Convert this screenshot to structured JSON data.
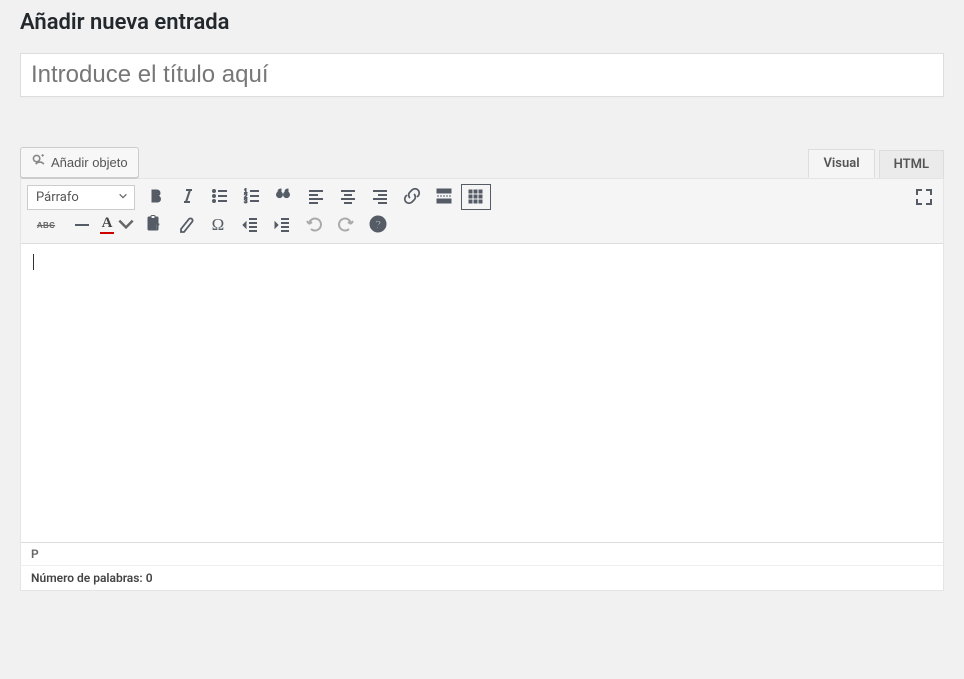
{
  "page": {
    "title": "Añadir nueva entrada"
  },
  "title_input": {
    "placeholder": "Introduce el título aquí",
    "value": ""
  },
  "media": {
    "add_label": "Añadir objeto"
  },
  "tabs": {
    "visual": "Visual",
    "html": "HTML",
    "active": "visual"
  },
  "format_select": {
    "value": "Párrafo"
  },
  "toolbar_row1": [
    {
      "name": "bold-icon"
    },
    {
      "name": "italic-icon"
    },
    {
      "name": "bullet-list-icon"
    },
    {
      "name": "numbered-list-icon"
    },
    {
      "name": "blockquote-icon"
    },
    {
      "name": "align-left-icon"
    },
    {
      "name": "align-center-icon"
    },
    {
      "name": "align-right-icon"
    },
    {
      "name": "link-icon"
    },
    {
      "name": "readmore-icon"
    },
    {
      "name": "toolbar-toggle-icon"
    }
  ],
  "toolbar_row2": [
    {
      "name": "strikethrough-icon"
    },
    {
      "name": "hr-icon"
    },
    {
      "name": "textcolor-icon"
    },
    {
      "name": "paste-text-icon"
    },
    {
      "name": "clear-format-icon"
    },
    {
      "name": "special-char-icon"
    },
    {
      "name": "outdent-icon"
    },
    {
      "name": "indent-icon"
    },
    {
      "name": "undo-icon"
    },
    {
      "name": "redo-icon"
    },
    {
      "name": "help-icon"
    }
  ],
  "distraction_free": {
    "name": "fullscreen-icon"
  },
  "editor": {
    "content": "",
    "path": "P"
  },
  "footer": {
    "word_count_label": "Número de palabras: ",
    "word_count_value": "0"
  }
}
